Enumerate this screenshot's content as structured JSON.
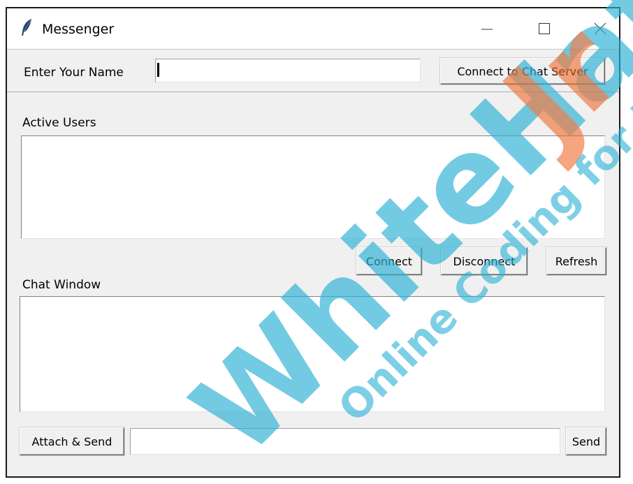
{
  "window": {
    "title": "Messenger",
    "controls": {
      "minimize": "minimize-icon",
      "maximize": "maximize-icon",
      "close": "close-icon"
    }
  },
  "name_row": {
    "label": "Enter Your Name",
    "input_value": "",
    "connect_server_label": "Connect to Chat Server"
  },
  "active_users": {
    "label": "Active Users",
    "items": [],
    "buttons": {
      "connect": "Connect",
      "disconnect": "Disconnect",
      "refresh": "Refresh"
    }
  },
  "chat": {
    "label": "Chat Window",
    "content": ""
  },
  "composer": {
    "attach_label": "Attach & Send",
    "input_value": "",
    "send_label": "Send"
  },
  "watermark": {
    "brand_main": "WhiteHat",
    "brand_suffix": "Jr",
    "tagline": "Online Coding for Kids",
    "colors": {
      "blue": "#2bb1d6",
      "orange": "#f0692a"
    }
  }
}
